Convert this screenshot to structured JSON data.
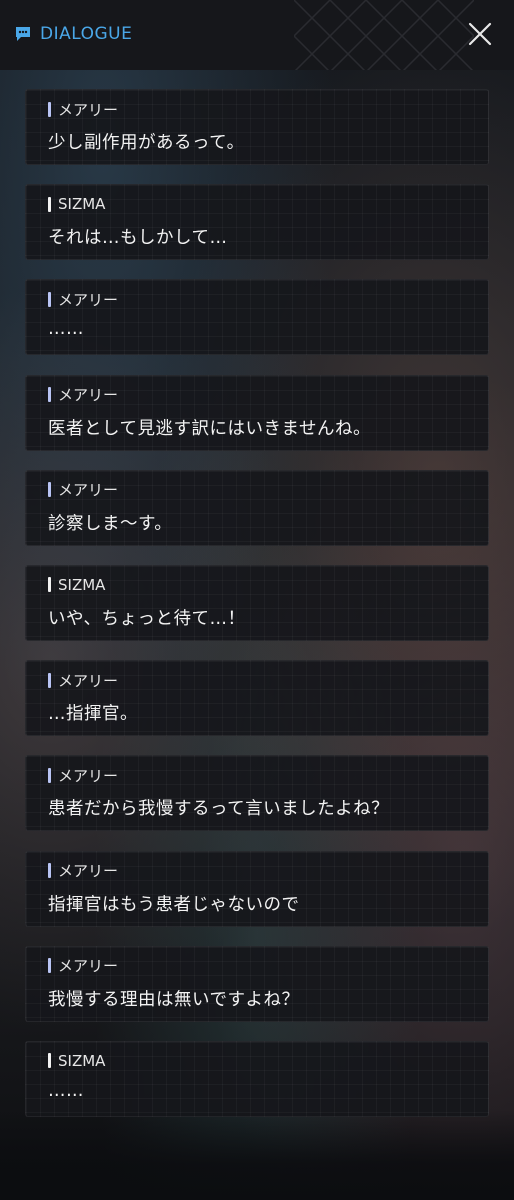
{
  "header": {
    "title": "DIALOGUE",
    "chat_icon": "chat-bubble-icon",
    "close_icon": "close-icon",
    "accent_color": "#4aa7e8"
  },
  "dialogue": [
    {
      "speaker": "メアリー",
      "text": "少し副作用があるって。",
      "marker": "blue"
    },
    {
      "speaker": "SIZMA",
      "text": "それは…もしかして…",
      "marker": "white"
    },
    {
      "speaker": "メアリー",
      "text": "……",
      "marker": "blue"
    },
    {
      "speaker": "メアリー",
      "text": "医者として見逃す訳にはいきませんね。",
      "marker": "blue"
    },
    {
      "speaker": "メアリー",
      "text": "診察しま～す。",
      "marker": "blue"
    },
    {
      "speaker": "SIZMA",
      "text": "いや、ちょっと待て…！",
      "marker": "white"
    },
    {
      "speaker": "メアリー",
      "text": "…指揮官。",
      "marker": "blue"
    },
    {
      "speaker": "メアリー",
      "text": "患者だから我慢するって言いましたよね？",
      "marker": "blue"
    },
    {
      "speaker": "メアリー",
      "text": "指揮官はもう患者じゃないので",
      "marker": "blue"
    },
    {
      "speaker": "メアリー",
      "text": "我慢する理由は無いですよね？",
      "marker": "blue"
    },
    {
      "speaker": "SIZMA",
      "text": "……",
      "marker": "white"
    }
  ]
}
